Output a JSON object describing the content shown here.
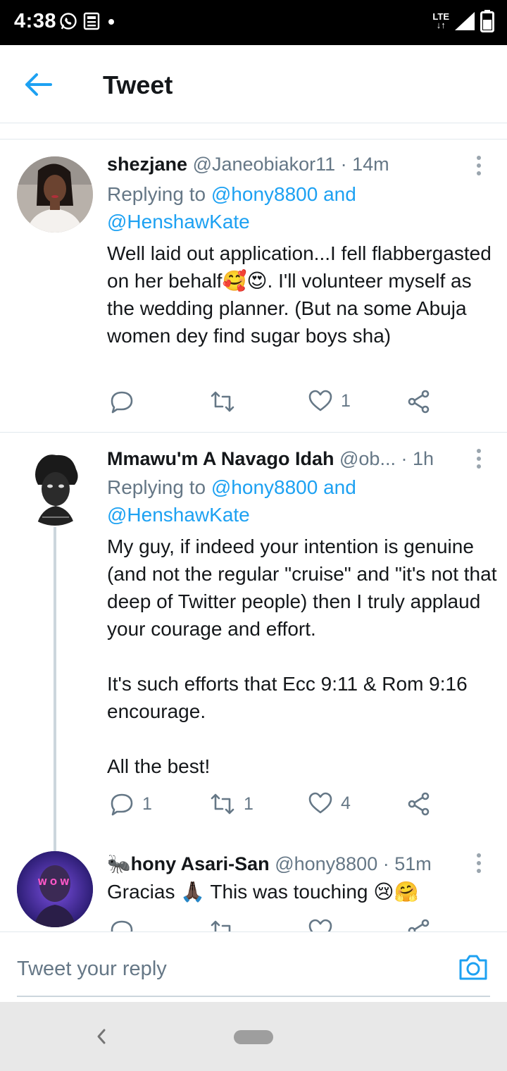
{
  "status_bar": {
    "time": "4:38",
    "network": "LTE"
  },
  "header": {
    "title": "Tweet"
  },
  "tweets": [
    {
      "name": "shezjane",
      "handle": "@Janeobiakor11",
      "time": "· 14m",
      "replying_prefix": "Replying to",
      "replying_to": "@hony8800 and @HenshawKate",
      "body": "Well laid out application...I fell flabbergasted on her behalf🥰😍. I'll volunteer myself as the wedding planner. (But na some Abuja women dey find sugar boys sha)",
      "replies": "",
      "retweets": "",
      "likes": "1"
    },
    {
      "name": "Mmawu'm A Navago Idah",
      "handle": "@ob...",
      "time": "· 1h",
      "replying_prefix": "Replying to",
      "replying_to": "@hony8800 and @HenshawKate",
      "body": "My guy, if indeed your intention is genuine (and not the regular \"cruise\" and \"it's not that deep of Twitter people) then I truly applaud your courage and effort.\n\nIt's such efforts that Ecc 9:11 & Rom 9:16 encourage.\n\nAll the best!",
      "replies": "1",
      "retweets": "1",
      "likes": "4"
    },
    {
      "name": "🐜hony Asari-San",
      "handle": "@hony8800",
      "time": "· 51m",
      "body": "Gracias 🙏🏿 This was touching 😢🤗",
      "avatar_text": "WOW"
    }
  ],
  "composer": {
    "placeholder": "Tweet your reply"
  },
  "colors": {
    "accent": "#1da1f2",
    "muted": "#657786",
    "text": "#14171a",
    "divider": "#e1e8ed"
  },
  "icons": [
    "arrow-left-icon",
    "more-vertical-icon",
    "reply-icon",
    "retweet-icon",
    "heart-icon",
    "share-icon",
    "camera-icon",
    "nav-back-icon",
    "whatsapp-icon",
    "news-icon",
    "signal-icon",
    "battery-icon"
  ]
}
